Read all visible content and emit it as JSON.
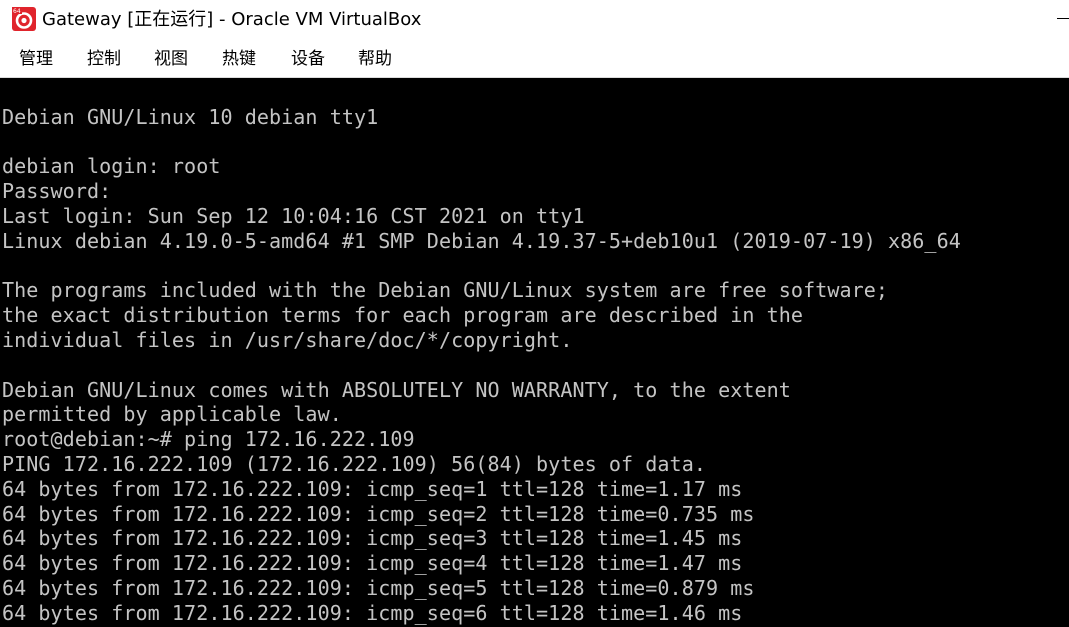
{
  "window": {
    "title": "Gateway [正在运行] - Oracle VM VirtualBox",
    "icon": "virtualbox-icon",
    "icon_badge": "64"
  },
  "menu": {
    "items": [
      {
        "label": "管理",
        "name": "menu-machine"
      },
      {
        "label": "控制",
        "name": "menu-control"
      },
      {
        "label": "视图",
        "name": "menu-view"
      },
      {
        "label": "热键",
        "name": "menu-input"
      },
      {
        "label": "设备",
        "name": "menu-devices"
      },
      {
        "label": "帮助",
        "name": "menu-help"
      }
    ]
  },
  "console": {
    "lines": [
      "",
      "Debian GNU/Linux 10 debian tty1",
      "",
      "debian login: root",
      "Password:",
      "Last login: Sun Sep 12 10:04:16 CST 2021 on tty1",
      "Linux debian 4.19.0-5-amd64 #1 SMP Debian 4.19.37-5+deb10u1 (2019-07-19) x86_64",
      "",
      "The programs included with the Debian GNU/Linux system are free software;",
      "the exact distribution terms for each program are described in the",
      "individual files in /usr/share/doc/*/copyright.",
      "",
      "Debian GNU/Linux comes with ABSOLUTELY NO WARRANTY, to the extent",
      "permitted by applicable law.",
      "root@debian:~# ping 172.16.222.109",
      "PING 172.16.222.109 (172.16.222.109) 56(84) bytes of data.",
      "64 bytes from 172.16.222.109: icmp_seq=1 ttl=128 time=1.17 ms",
      "64 bytes from 172.16.222.109: icmp_seq=2 ttl=128 time=0.735 ms",
      "64 bytes from 172.16.222.109: icmp_seq=3 ttl=128 time=1.45 ms",
      "64 bytes from 172.16.222.109: icmp_seq=4 ttl=128 time=1.47 ms",
      "64 bytes from 172.16.222.109: icmp_seq=5 ttl=128 time=0.879 ms",
      "64 bytes from 172.16.222.109: icmp_seq=6 ttl=128 time=1.46 ms"
    ]
  },
  "colors": {
    "console_bg": "#000000",
    "console_fg": "#c4c4c4",
    "chrome_bg": "#ffffff",
    "icon_red": "#e0242c"
  }
}
